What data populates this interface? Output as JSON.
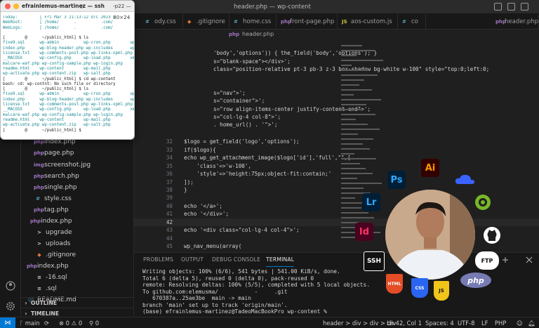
{
  "window": {
    "title": "header.php — wp-content"
  },
  "tabs": [
    {
      "label": "ody.css",
      "icon": "#"
    },
    {
      "label": ".gitignore",
      "icon": "◆"
    },
    {
      "label": "home.css",
      "icon": "#"
    },
    {
      "label": "front-page.php",
      "icon": "php"
    },
    {
      "label": "aos-custom.js",
      "icon": "JS"
    },
    {
      "label": "co",
      "icon": "#"
    },
    {
      "label": "header.php",
      "icon": "php"
    }
  ],
  "breadcrumb": "header.php",
  "editor": {
    "lines": [
      {
        "n": "",
        "code": "'body','options')) { the_field('body','options'); }"
      },
      {
        "n": "",
        "code": "s=\"blank-space\"></div>';"
      },
      {
        "n": "",
        "code": "class=\"position-relative pt-3 pb-3 z-3 box-shadow bg-white w-100\" style=\"top:0;left:0;"
      },
      {
        "n": "",
        "code": ""
      },
      {
        "n": "",
        "code": "s=\"nav\">';"
      },
      {
        "n": "",
        "code": "s=\"container\">';"
      },
      {
        "n": "",
        "code": "s=\"row align-items-center justify-content-end\">';"
      },
      {
        "n": "",
        "code": "s=\"col-lg-4 col-8\">';"
      },
      {
        "n": "",
        "code": ". home_url() . '\">';"
      },
      {
        "n": "",
        "code": ""
      },
      {
        "n": "",
        "code": ""
      },
      {
        "n": "",
        "code": ""
      },
      {
        "n": "32",
        "code": "$logo = get_field('logo','options');"
      },
      {
        "n": "33",
        "code": "if($logo){"
      },
      {
        "n": "34",
        "code": "echo wp_get_attachment_image($logo['id'],'full',\"\",["
      },
      {
        "n": "35",
        "code": "    'class'=>'w-100',"
      },
      {
        "n": "36",
        "code": "    'style'=>'height:75px;object-fit:contain;'"
      },
      {
        "n": "37",
        "code": "]);"
      },
      {
        "n": "38",
        "code": "}"
      },
      {
        "n": "39",
        "code": ""
      },
      {
        "n": "40",
        "code": "echo '</a>';"
      },
      {
        "n": "41",
        "code": "echo '</div>';"
      },
      {
        "n": "42",
        "code": ""
      },
      {
        "n": "43",
        "code": "echo '<div class=\"col-lg-4 col-4\">';"
      },
      {
        "n": "44",
        "code": ""
      },
      {
        "n": "45",
        "code": "wp_nav_menu(array("
      }
    ]
  },
  "explorer": {
    "items": [
      {
        "label": "header.php",
        "icon": "php",
        "indent": 1,
        "selected": true
      },
      {
        "label": "index.php",
        "icon": "php",
        "indent": 1
      },
      {
        "label": "page.php",
        "icon": "php",
        "indent": 1
      },
      {
        "label": "screenshot.jpg",
        "icon": "img",
        "indent": 1
      },
      {
        "label": "search.php",
        "icon": "php",
        "indent": 1
      },
      {
        "label": "single.php",
        "icon": "php",
        "indent": 1
      },
      {
        "label": "style.css",
        "icon": "#",
        "indent": 1
      },
      {
        "label": "tag.php",
        "icon": "php",
        "indent": 1
      },
      {
        "label": "index.php",
        "icon": "php",
        "indent": 0
      },
      {
        "label": "upgrade",
        "icon": ">",
        "indent": -1
      },
      {
        "label": "uploads",
        "icon": ">",
        "indent": -1
      },
      {
        "label": ".gitignore",
        "icon": "◆",
        "indent": -1
      },
      {
        "label": "index.php",
        "icon": "php",
        "indent": -2
      },
      {
        "label": "-16.sql",
        "icon": "≡",
        "indent": -1
      },
      {
        "label": ".sql",
        "icon": "≡",
        "indent": -1
      },
      {
        "label": "README.md",
        "icon": "ⓘ",
        "indent": -2
      }
    ],
    "outline": "OUTLINE",
    "timeline": "TIMELINE"
  },
  "panel": {
    "tabs": [
      "PROBLEMS",
      "OUTPUT",
      "DEBUG CONSOLE",
      "TERMINAL"
    ],
    "terminal": [
      "Writing objects: 100% (6/6), 541 bytes | 541.00 KiB/s, done.",
      "Total 6 (delta 5), reused 0 (delta 0), pack-reused 0",
      "remote: Resolving deltas: 100% (5/5), completed with 5 local objects.",
      "To github.com:elemusma/           -     .git",
      "   670387a..25ae3be  main -> main",
      "branch 'main' set up to track 'origin/main'.",
      "(base) efrainlemus-martinez@TadeoMacBookPro wp-content % "
    ]
  },
  "status": {
    "branch": "main",
    "sync": "",
    "problems": "⊗ 0 ⚠ 0",
    "ports": "0",
    "breadcrumb": "header > div > div > div",
    "position": "Ln 42, Col 1",
    "spaces": "Spaces: 4",
    "encoding": "UTF-8",
    "eol": "LF",
    "language": "PHP"
  },
  "ssh": {
    "title": "efrainlemus-martinez — ssh",
    "size": "-p22 — 80×24",
    "lines": [
      "Today:         [ Fri Mar 3 21:13:12 UTC 2023 ]",
      "WebRoot:       [ /home/      .          .com/          /public_html ]",
      "WebLogs:       [ /home/      .          .com/          /logs ]",
      "",
      "[        @      ~/public_html] $ ls",
      "five9.sql      wp-admin          wp-cron.php        wp-settings.php",
      "index.php      wp-blog-header.php wp-includes       wp-signup.php",
      "license.txt    wp-comments-post.php wp-links-opml.php wp-trackback.php",
      "__MACOSX       wp-config.php     wp-load.php        xmlrpc.php",
      "malcare-waf.php wp-config-sample.php wp-login.php",
      "readme.html    wp-content        wp-mail.php",
      "wp-activate.php wp-content.zip   wp-salt.php",
      "[        @      ~/public_html] $ cd wp-content",
      "bash: cd: wp-contnt: No such file or directory",
      "[        @      ~/public_html] $ ls",
      "five9.sql      wp-admin          wp-cron.php        wp-settings.php",
      "index.php      wp-blog-header.php wp-includes       wp-signup.php",
      "license.txt    wp-comments-post.php wp-links-opml.php wp-trackback.php",
      "__MACOSX       wp-config.php     wp-load.php        xmlrpc.php",
      "malcare-waf.php wp-config-sample.php wp-login.php",
      "readme.html    wp-content        wp-mail.php",
      "wp-activate.php wp-content.zip   wp-salt.php",
      "[        @      ~/public_html] $ "
    ]
  },
  "badges": {
    "ai": "Ai",
    "ps": "Ps",
    "lr": "Lr",
    "id": "Id",
    "ssh": "SSH",
    "html": "HTML",
    "css": "CSS",
    "js": "JS",
    "ftp": "FTP",
    "php": "php"
  },
  "colors": {
    "accent": "#0078d4",
    "ai": "#ff9a00",
    "ps": "#31a8ff",
    "lr": "#31a8ff",
    "id": "#ff3366",
    "html": "#e44d26",
    "css": "#2965f1",
    "js": "#f0c419"
  }
}
